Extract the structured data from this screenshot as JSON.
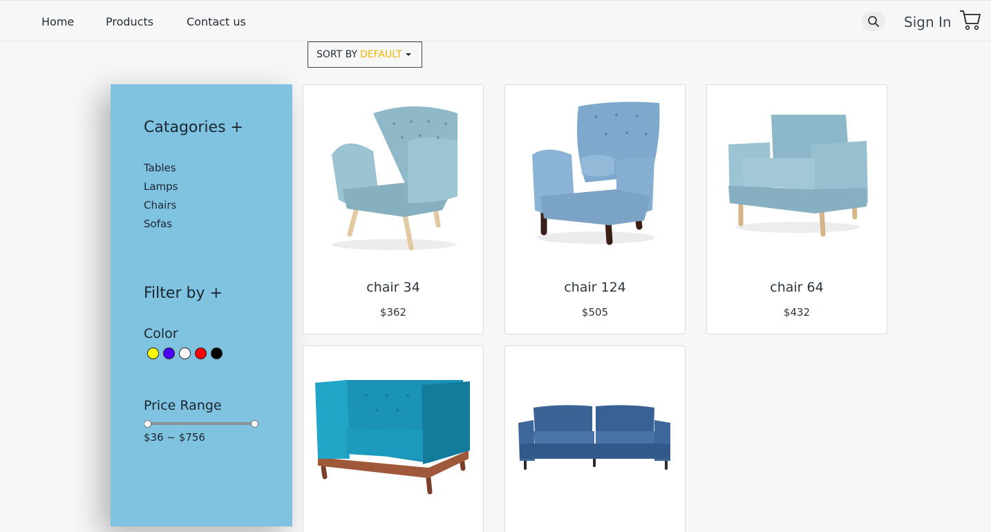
{
  "nav": {
    "links": [
      "Home",
      "Products",
      "Contact us"
    ],
    "sign_in": "Sign In",
    "search_icon": "search-icon",
    "cart_icon": "cart-icon"
  },
  "sort": {
    "label": "SORT BY",
    "value": "DEFAULT",
    "value_color": "#f2b705"
  },
  "sidebar": {
    "background": "#7fc3e0",
    "categories_heading": "Catagories +",
    "categories": [
      "Tables",
      "Lamps",
      "Chairs",
      "Sofas"
    ],
    "filter_heading": "Filter by +",
    "color_heading": "Color",
    "colors": [
      "#ffff00",
      "#4a00ff",
      "#ffffff",
      "#ff0000",
      "#000000"
    ],
    "price_heading": "Price Range",
    "price_range": "$36 ~ $756",
    "price_min": 36,
    "price_max": 756
  },
  "products": [
    {
      "name": "chair 34",
      "price": "$362",
      "image": "armchair-light-blue-tufted"
    },
    {
      "name": "chair 124",
      "price": "$505",
      "image": "wingback-chair-blue"
    },
    {
      "name": "chair 64",
      "price": "$432",
      "image": "square-armchair-light-blue"
    },
    {
      "name": "",
      "price": "",
      "image": "armchair-teal-tufted"
    },
    {
      "name": "",
      "price": "",
      "image": "sofa-navy-blue"
    }
  ]
}
